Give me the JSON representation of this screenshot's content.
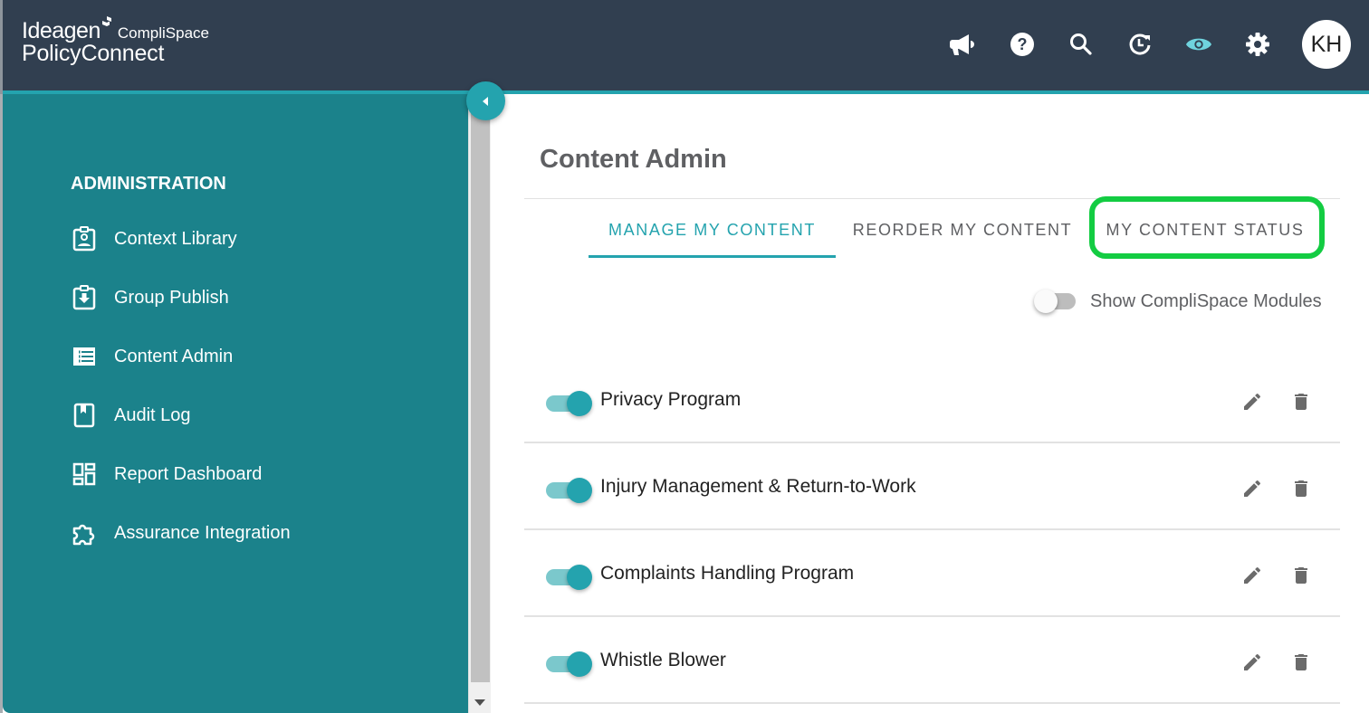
{
  "header": {
    "brand": {
      "ideagen": "Ideagen",
      "complispace": "CompliSpace",
      "product": "PolicyConnect"
    },
    "icons": [
      {
        "name": "announcements-icon"
      },
      {
        "name": "help-icon"
      },
      {
        "name": "search-icon"
      },
      {
        "name": "history-icon"
      },
      {
        "name": "preview-eye-icon",
        "color": "#6fd3de"
      },
      {
        "name": "settings-gear-icon"
      }
    ],
    "avatar_initials": "KH"
  },
  "sidebar": {
    "section_title": "ADMINISTRATION",
    "items": [
      {
        "label": "Context Library",
        "icon": "contact-badge-icon"
      },
      {
        "label": "Group Publish",
        "icon": "clipboard-download-icon"
      },
      {
        "label": "Content Admin",
        "icon": "list-icon"
      },
      {
        "label": "Audit Log",
        "icon": "book-bookmark-icon"
      },
      {
        "label": "Report Dashboard",
        "icon": "dashboard-icon"
      },
      {
        "label": "Assurance Integration",
        "icon": "puzzle-icon"
      }
    ]
  },
  "main": {
    "title": "Content Admin",
    "tabs": [
      {
        "label": "MANAGE MY CONTENT",
        "active": true
      },
      {
        "label": "REORDER MY CONTENT",
        "active": false
      },
      {
        "label": "MY CONTENT STATUS",
        "active": false,
        "highlighted": true
      }
    ],
    "show_modules_toggle": {
      "label": "Show CompliSpace Modules",
      "on": false
    },
    "content_items": [
      {
        "name": "Privacy Program",
        "enabled": true
      },
      {
        "name": "Injury Management & Return-to-Work",
        "enabled": true
      },
      {
        "name": "Complaints Handling Program",
        "enabled": true
      },
      {
        "name": "Whistle Blower",
        "enabled": true
      }
    ]
  },
  "colors": {
    "header_bg": "#313f50",
    "accent": "#24a3ae",
    "sidebar_bg": "#1b828b",
    "highlight": "#13cc42"
  }
}
